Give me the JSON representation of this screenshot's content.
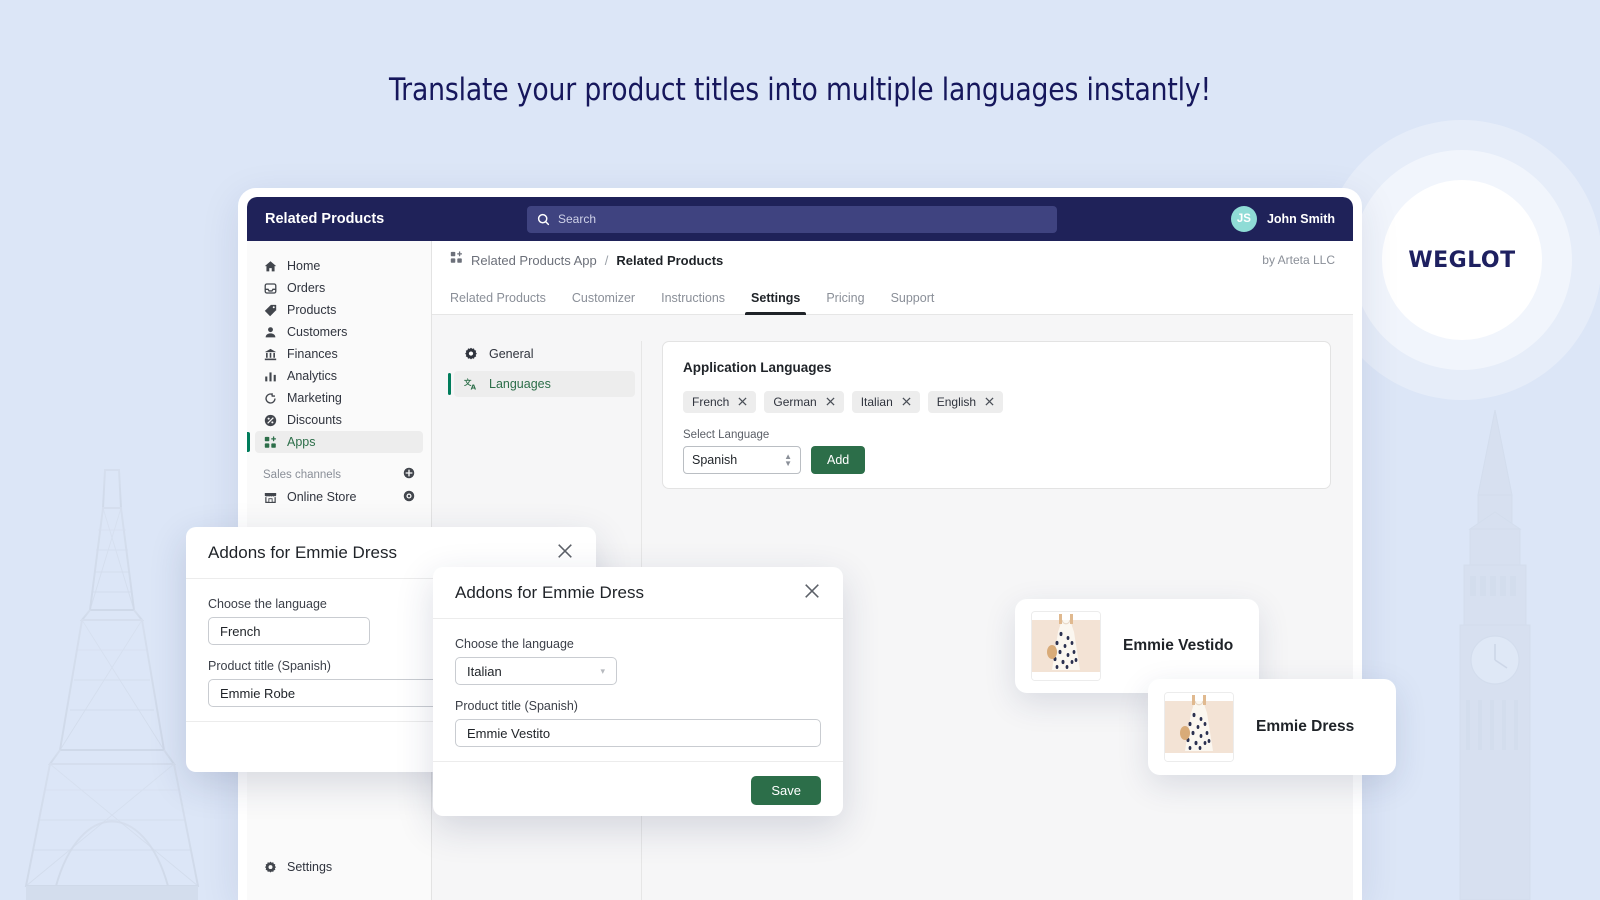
{
  "headline": "Translate your product titles into multiple languages instantly!",
  "brand": {
    "logo_text": "WEGLOT"
  },
  "colors": {
    "page_background": "#dce6f7",
    "topbar": "#1f2259",
    "accent_green": "#2c6e49",
    "avatar": "#8fdcd6",
    "headline_text": "#16175c"
  },
  "topbar": {
    "title": "Related Products",
    "search_placeholder": "Search",
    "search_value": "",
    "search_icon": "search-icon",
    "user": {
      "initials": "JS",
      "name": "John Smith"
    }
  },
  "sidebar": {
    "items": [
      {
        "label": "Home",
        "icon": "home-icon",
        "active": false
      },
      {
        "label": "Orders",
        "icon": "orders-icon",
        "active": false
      },
      {
        "label": "Products",
        "icon": "tag-icon",
        "active": false
      },
      {
        "label": "Customers",
        "icon": "person-icon",
        "active": false
      },
      {
        "label": "Finances",
        "icon": "bank-icon",
        "active": false
      },
      {
        "label": "Analytics",
        "icon": "bar-chart-icon",
        "active": false
      },
      {
        "label": "Marketing",
        "icon": "megaphone-icon",
        "active": false
      },
      {
        "label": "Discounts",
        "icon": "discount-icon",
        "active": false
      },
      {
        "label": "Apps",
        "icon": "apps-icon",
        "active": true
      }
    ],
    "section_label": "Sales channels",
    "section_add_icon": "plus-circle-icon",
    "channels": [
      {
        "label": "Online Store",
        "icon": "storefront-icon",
        "trailing_icon": "eye-icon"
      }
    ],
    "bottom": {
      "label": "Settings",
      "icon": "gear-icon"
    }
  },
  "breadcrumb": {
    "app_icon": "apps-icon",
    "parent": "Related Products App",
    "separator": "/",
    "current": "Related Products",
    "author": "by Arteta LLC"
  },
  "tabs": [
    {
      "label": "Related Products",
      "active": false
    },
    {
      "label": "Customizer",
      "active": false
    },
    {
      "label": "Instructions",
      "active": false
    },
    {
      "label": "Settings",
      "active": true
    },
    {
      "label": "Pricing",
      "active": false
    },
    {
      "label": "Support",
      "active": false
    }
  ],
  "settings_nav": [
    {
      "label": "General",
      "icon": "gear-icon",
      "active": false
    },
    {
      "label": "Languages",
      "icon": "translate-icon",
      "active": true
    }
  ],
  "languages_panel": {
    "title": "Application Languages",
    "chips": [
      {
        "label": "French",
        "remove_icon": "close-icon"
      },
      {
        "label": "German",
        "remove_icon": "close-icon"
      },
      {
        "label": "Italian",
        "remove_icon": "close-icon"
      },
      {
        "label": "English",
        "remove_icon": "close-icon"
      }
    ],
    "select_label": "Select Language",
    "select_value": "Spanish",
    "select_options": [
      "Spanish"
    ],
    "add_button": "Add"
  },
  "modal_back": {
    "title": "Addons for Emmie Dress",
    "close_icon": "close-icon",
    "language_label": "Choose the language",
    "language_value": "French",
    "title_label": "Product title (Spanish)",
    "title_value": "Emmie Robe"
  },
  "modal_front": {
    "title": "Addons for Emmie Dress",
    "close_icon": "close-icon",
    "language_label": "Choose the language",
    "language_value": "Italian",
    "title_label": "Product title (Spanish)",
    "title_value": "Emmie Vestito",
    "save_button": "Save"
  },
  "product_cards": [
    {
      "name": "Emmie Vestido",
      "thumb": "dress-thumbnail"
    },
    {
      "name": "Emmie Dress",
      "thumb": "dress-thumbnail"
    }
  ]
}
